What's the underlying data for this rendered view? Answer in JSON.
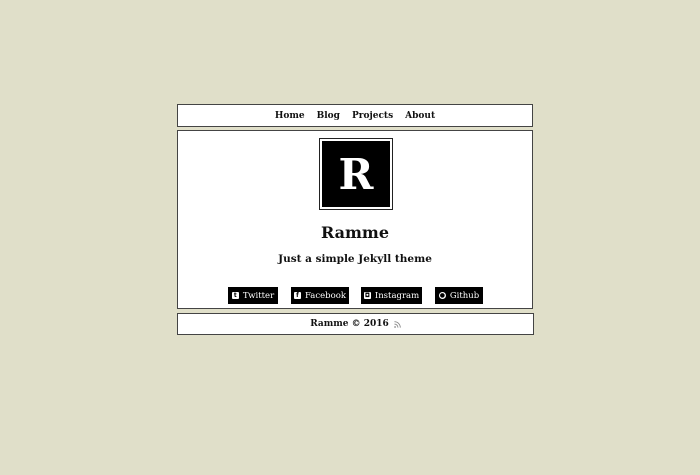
{
  "nav": {
    "items": [
      {
        "label": "Home"
      },
      {
        "label": "Blog"
      },
      {
        "label": "Projects"
      },
      {
        "label": "About"
      }
    ]
  },
  "header": {
    "logo_letter": "R",
    "title": "Ramme",
    "tagline": "Just a simple Jekyll theme"
  },
  "social": {
    "twitter": {
      "label": "Twitter",
      "icon": "twitter-icon"
    },
    "facebook": {
      "label": "Facebook",
      "icon": "facebook-icon"
    },
    "instagram": {
      "label": "Instagram",
      "icon": "instagram-icon"
    },
    "github": {
      "label": "Github",
      "icon": "github-icon"
    }
  },
  "footer": {
    "text": "Ramme © 2016",
    "icon": "rss-icon"
  },
  "colors": {
    "background": "#e0dfc9",
    "panel": "#ffffff",
    "button": "#000000",
    "text": "#111111"
  }
}
